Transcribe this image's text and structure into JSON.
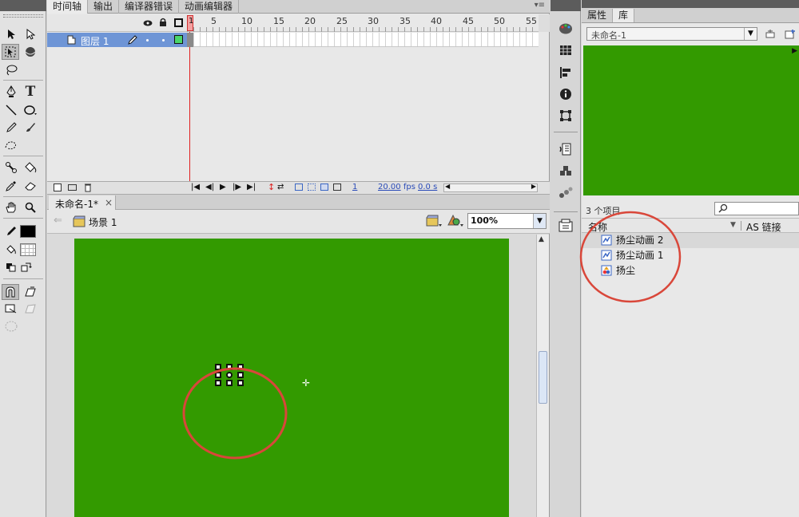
{
  "timeline_panel": {
    "tabs": [
      "时间轴",
      "输出",
      "编译器错误",
      "动画编辑器"
    ],
    "frame_numbers": [
      "1",
      "5",
      "10",
      "15",
      "20",
      "25",
      "30",
      "35",
      "40",
      "45",
      "50",
      "55"
    ],
    "layer_name": "图层 1",
    "status": {
      "frame": "1",
      "fps": "20.00",
      "fps_unit": "fps",
      "time": "0.0 s"
    }
  },
  "document": {
    "tab_label": "未命名-1*",
    "tab_close": "×",
    "scene_label": "场景 1",
    "zoom": "100%"
  },
  "right_panel": {
    "tabs": [
      "属性",
      "库"
    ],
    "library_dropdown": "未命名-1",
    "item_count": "3 个项目",
    "search_placeholder": "",
    "col_name": "名称",
    "col_as": "AS 链接",
    "items": [
      {
        "name": "扬尘动画 2",
        "type": "movie-clip"
      },
      {
        "name": "扬尘动画 1",
        "type": "movie-clip"
      },
      {
        "name": "扬尘",
        "type": "graphic"
      }
    ]
  },
  "colors": {
    "stage": "#339a00",
    "annotation": "#d9473a",
    "layer_selected": "#6e95d6",
    "playhead": "#e02020",
    "panel": "#e8e8e8"
  }
}
